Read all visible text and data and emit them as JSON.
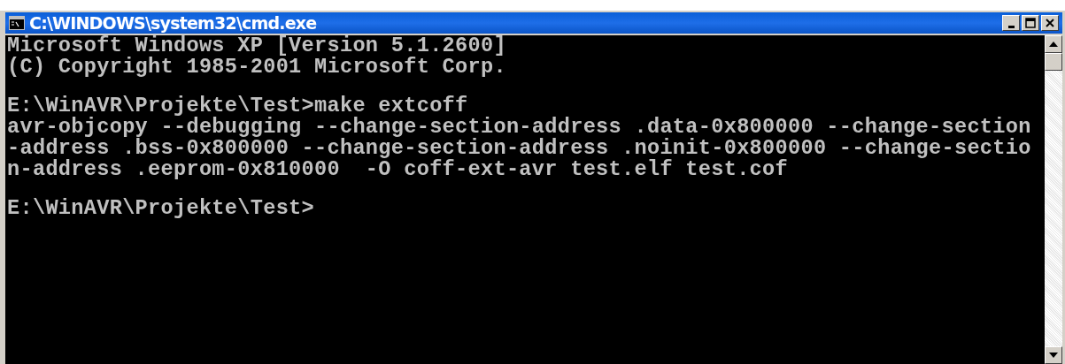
{
  "window": {
    "title": "C:\\WINDOWS\\system32\\cmd.exe"
  },
  "console": {
    "blocks": [
      [
        "Microsoft Windows XP [Version 5.1.2600]",
        "(C) Copyright 1985-2001 Microsoft Corp."
      ],
      [
        "E:\\WinAVR\\Projekte\\Test>make extcoff",
        "avr-objcopy --debugging --change-section-address .data-0x800000 --change-section",
        "-address .bss-0x800000 --change-section-address .noinit-0x800000 --change-sectio",
        "n-address .eeprom-0x810000  -O coff-ext-avr test.elf test.cof"
      ],
      [
        "E:\\WinAVR\\Projekte\\Test>"
      ]
    ]
  }
}
